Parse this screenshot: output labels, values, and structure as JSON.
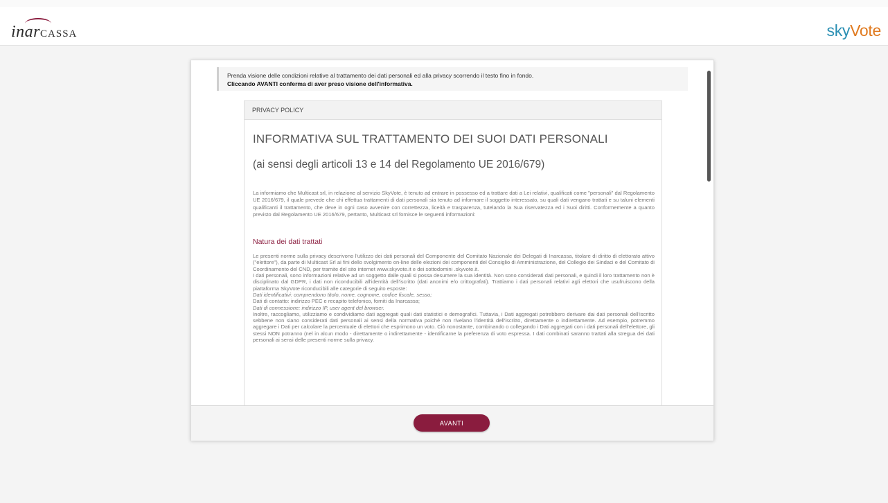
{
  "header": {
    "left_logo_text": "inarCASSA",
    "right_logo_sky": "sky",
    "right_logo_vote": "Vote"
  },
  "notice": {
    "line1": "Prenda visione delle condizioni relative al trattamento dei dati personali ed alla privacy scorrendo il testo fino in fondo.",
    "line2": "Cliccando AVANTI conferma di aver preso visione dell'informativa."
  },
  "policy": {
    "header": "PRIVACY POLICY",
    "title": "INFORMATIVA SUL TRATTAMENTO DEI SUOI DATI PERSONALI",
    "subtitle": "(ai sensi degli articoli 13 e 14 del Regolamento UE 2016/679)",
    "intro": "La informiamo che Multicast srl, in relazione al servizio SkyVote, è tenuto ad entrare in possesso ed a trattare dati a Lei relativi, qualificati come \"personali\" dal Regolamento UE 2016/679, il quale prevede che chi effettua trattamenti di dati personali sia tenuto ad informare il soggetto interessato, su quali dati vengano trattati e su taluni elementi qualificanti il trattamento, che deve in ogni caso avvenire con correttezza, liceità e trasparenza, tutelando la Sua riservatezza ed i Suoi diritti. Conformemente a quanto previsto dal Regolamento UE 2016/679, pertanto, Multicast srl fornisce le seguenti informazioni:",
    "section_title": "Natura dei dati trattati",
    "section_p1": "Le presenti norme sulla privacy descrivono l'utilizzo dei dati personali del Componente del Comitato Nazionale dei Delegati di Inarcassa, titolare di diritto di elettorato attivo (\"elettore\"), da parte di Multicast Srl ai fini dello svolgimento on-line delle elezioni dei componenti del Consiglio di Amministrazione, del Collegio dei Sindaci e del Comitato di Coordinamento del CND, per tramite del sito internet www.skyvote.it e dei sottodomini .skyvote.it.",
    "section_p2": "I dati personali, sono informazioni relative ad un soggetto dalle quali si possa desumere la sua identità. Non sono considerati dati personali, e quindi il loro trattamento non è disciplinato dal GDPR, i dati non riconducibili all'identità dell'iscritto (dati anonimi e/o crittografati). Trattiamo i dati personali relativi agli elettori che usufruiscono della piattaforma SkyVote riconducibili alle categorie di seguito esposte:",
    "line_identificativi": "Dati identificativi: comprendono titolo, nome, cognome, codice fiscale, sesso;",
    "line_contatto": "Dati di contatto: indirizzo PEC e recapito telefonico, forniti da Inarcassa;",
    "line_connessione": "Dati di connessione: indirizzo IP, user agent del browser.",
    "section_p3": "Inoltre, raccogliamo, utilizziamo e condividiamo dati aggregati quali dati statistici e demografici. Tuttavia, i Dati aggregati potrebbero derivare dai dati personali dell'iscritto sebbene non siano considerati dati personali ai sensi della normativa poiché non rivelano l'identità dell'iscritto, direttamente o indirettamente. Ad esempio, potremmo aggregare i Dati per calcolare la percentuale di elettori che esprimono un voto. Ciò nonostante, combinando o collegando i Dati aggregati con i dati personali dell'elettore, gli stessi NON potranno (nel in alcun modo - direttamente o indirettamente - identificarne la preferenza di voto espressa. I dati combinati saranno trattati alla stregua dei dati personali ai sensi delle presenti norme sulla privacy."
  },
  "footer": {
    "avanti_label": "AVANTI"
  },
  "colors": {
    "brand_bordeaux": "#8a1c3e",
    "sky_blue": "#2a8fb3",
    "vote_orange": "#e07a1f"
  }
}
